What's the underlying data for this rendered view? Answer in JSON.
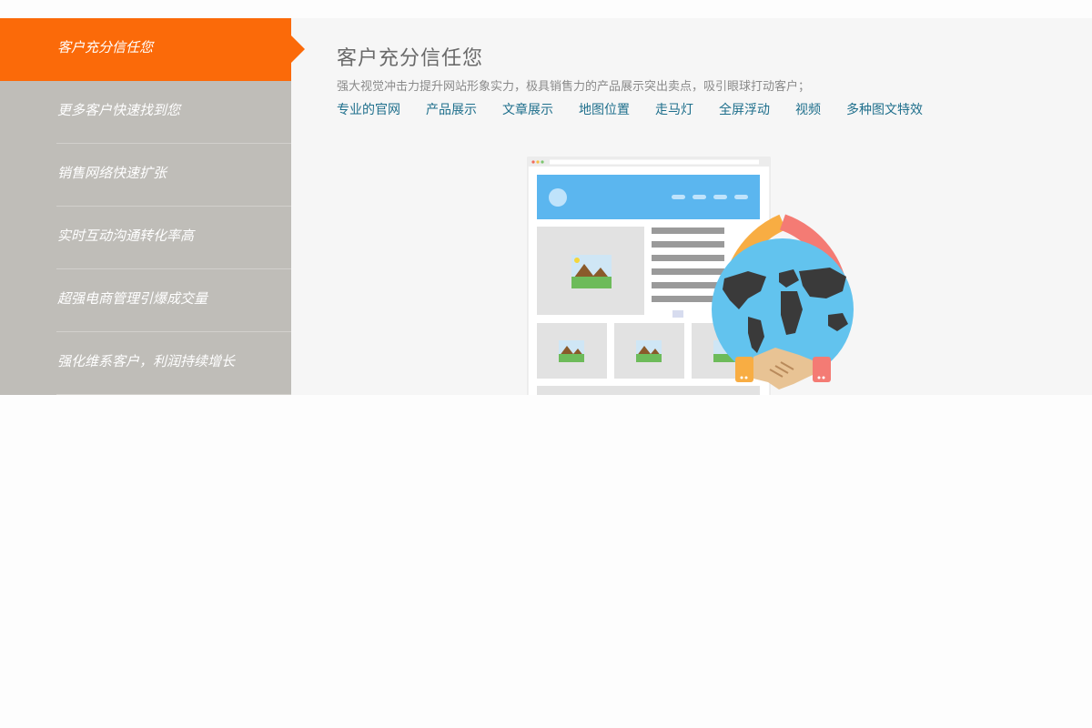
{
  "sidebar": {
    "items": [
      {
        "label": "客户充分信任您",
        "active": true
      },
      {
        "label": "更多客户快速找到您",
        "active": false
      },
      {
        "label": "销售网络快速扩张",
        "active": false
      },
      {
        "label": "实时互动沟通转化率高",
        "active": false
      },
      {
        "label": "超强电商管理引爆成交量",
        "active": false
      },
      {
        "label": "强化维系客户，利润持续增长",
        "active": false
      }
    ]
  },
  "main": {
    "title": "客户充分信任您",
    "subtitle": "强大视觉冲击力提升网站形象实力，极具销售力的产品展示突出卖点，吸引眼球打动客户；",
    "links": [
      "专业的官网",
      "产品展示",
      "文章展示",
      "地图位置",
      "走马灯",
      "全屏浮动",
      "视频",
      "多种图文特效"
    ]
  },
  "colors": {
    "accent": "#fb6a09",
    "sidebar_bg": "#bfbdb8",
    "link": "#1e6f8c"
  }
}
